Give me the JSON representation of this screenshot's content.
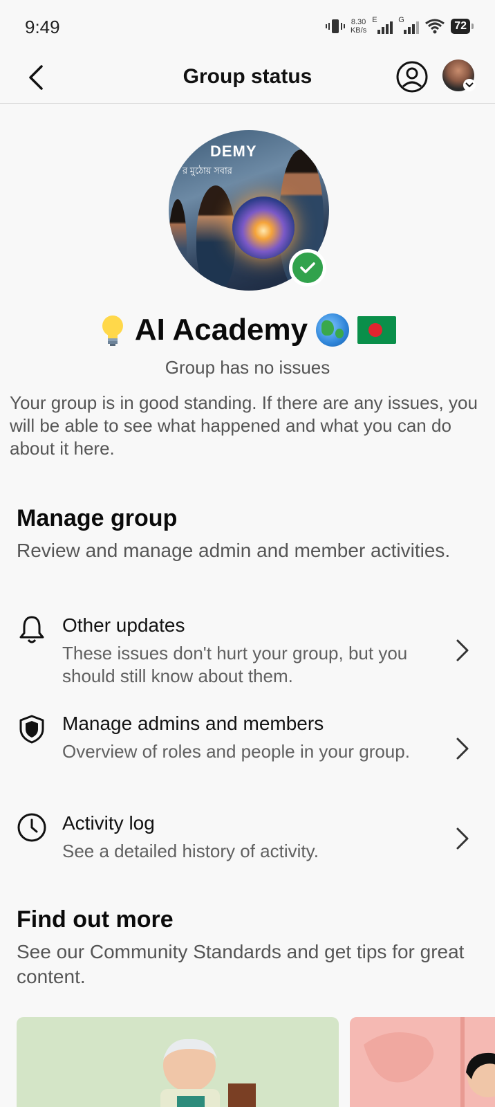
{
  "status_bar": {
    "time": "9:49",
    "net_speed_value": "8.30",
    "net_speed_unit": "KB/s",
    "sim1_label": "E",
    "sim2_label": "G",
    "battery": "72"
  },
  "header": {
    "title": "Group status"
  },
  "group": {
    "photo_text": "DEMY",
    "photo_subtext": "র মুঠোয় সবার",
    "name": "AI Academy",
    "status": "Group has no issues",
    "description": "Your group is in good standing. If there are any issues, you will be able to see what happened and what you can do about it here."
  },
  "manage": {
    "title": "Manage group",
    "subtitle": "Review and manage admin and member activities.",
    "items": [
      {
        "title": "Other updates",
        "subtitle": "These issues don't hurt your group, but you should still know about them.",
        "icon": "bell-icon"
      },
      {
        "title": "Manage admins and members",
        "subtitle": "Overview of roles and people in your group.",
        "icon": "shield-icon"
      },
      {
        "title": "Activity log",
        "subtitle": "See a detailed history of activity.",
        "icon": "clock-icon"
      }
    ]
  },
  "find_out_more": {
    "title": "Find out more",
    "subtitle": "See our Community Standards and get tips for great content."
  },
  "colors": {
    "verified": "#31a24c",
    "background": "#f8f8f8"
  }
}
